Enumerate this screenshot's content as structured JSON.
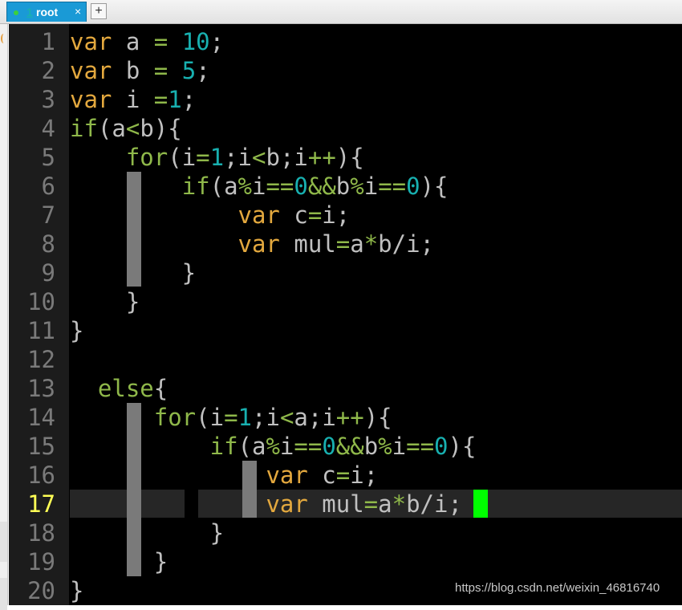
{
  "tab": {
    "index": "1",
    "name": "root",
    "close_symbol": "×",
    "new_tab_symbol": "+"
  },
  "editor": {
    "current_line": 17,
    "lines": [
      {
        "n": "1"
      },
      {
        "n": "2"
      },
      {
        "n": "3"
      },
      {
        "n": "4"
      },
      {
        "n": "5"
      },
      {
        "n": "6"
      },
      {
        "n": "7"
      },
      {
        "n": "8"
      },
      {
        "n": "9"
      },
      {
        "n": "10"
      },
      {
        "n": "11"
      },
      {
        "n": "12"
      },
      {
        "n": "13"
      },
      {
        "n": "14"
      },
      {
        "n": "15"
      },
      {
        "n": "16"
      },
      {
        "n": "17"
      },
      {
        "n": "18"
      },
      {
        "n": "19"
      },
      {
        "n": "20"
      }
    ],
    "code": [
      [
        [
          "kw",
          "var"
        ],
        [
          "t",
          " a "
        ],
        [
          "op",
          "="
        ],
        [
          "t",
          " "
        ],
        [
          "num",
          "10"
        ],
        [
          "t",
          ";"
        ]
      ],
      [
        [
          "kw",
          "var"
        ],
        [
          "t",
          " b "
        ],
        [
          "op",
          "="
        ],
        [
          "t",
          " "
        ],
        [
          "num",
          "5"
        ],
        [
          "t",
          ";"
        ]
      ],
      [
        [
          "kw",
          "var"
        ],
        [
          "t",
          " i "
        ],
        [
          "op",
          "="
        ],
        [
          "num",
          "1"
        ],
        [
          "t",
          ";"
        ]
      ],
      [
        [
          "ctl",
          "if"
        ],
        [
          "t",
          "(a"
        ],
        [
          "op",
          "<"
        ],
        [
          "t",
          "b){"
        ]
      ],
      [
        [
          "t",
          "    "
        ],
        [
          "ctl",
          "for"
        ],
        [
          "t",
          "(i"
        ],
        [
          "op",
          "="
        ],
        [
          "num",
          "1"
        ],
        [
          "t",
          ";i"
        ],
        [
          "op",
          "<"
        ],
        [
          "t",
          "b;i"
        ],
        [
          "op",
          "++"
        ],
        [
          "t",
          "){"
        ]
      ],
      [
        [
          "t",
          "        "
        ],
        [
          "ctl",
          "if"
        ],
        [
          "t",
          "(a"
        ],
        [
          "op",
          "%"
        ],
        [
          "t",
          "i"
        ],
        [
          "op",
          "=="
        ],
        [
          "num",
          "0"
        ],
        [
          "op",
          "&&"
        ],
        [
          "t",
          "b"
        ],
        [
          "op",
          "%"
        ],
        [
          "t",
          "i"
        ],
        [
          "op",
          "=="
        ],
        [
          "num",
          "0"
        ],
        [
          "t",
          "){"
        ]
      ],
      [
        [
          "t",
          "            "
        ],
        [
          "kw",
          "var"
        ],
        [
          "t",
          " c"
        ],
        [
          "op",
          "="
        ],
        [
          "t",
          "i;"
        ]
      ],
      [
        [
          "t",
          "            "
        ],
        [
          "kw",
          "var"
        ],
        [
          "t",
          " mul"
        ],
        [
          "op",
          "="
        ],
        [
          "t",
          "a"
        ],
        [
          "op",
          "*"
        ],
        [
          "t",
          "b/i;"
        ]
      ],
      [
        [
          "t",
          "        }"
        ]
      ],
      [
        [
          "t",
          "    }"
        ]
      ],
      [
        [
          "t",
          "}"
        ]
      ],
      [],
      [
        [
          "t",
          "  "
        ],
        [
          "ctl",
          "else"
        ],
        [
          "t",
          "{"
        ]
      ],
      [
        [
          "t",
          "      "
        ],
        [
          "ctl",
          "for"
        ],
        [
          "t",
          "(i"
        ],
        [
          "op",
          "="
        ],
        [
          "num",
          "1"
        ],
        [
          "t",
          ";i"
        ],
        [
          "op",
          "<"
        ],
        [
          "t",
          "a;i"
        ],
        [
          "op",
          "++"
        ],
        [
          "t",
          "){"
        ]
      ],
      [
        [
          "t",
          "          "
        ],
        [
          "ctl",
          "if"
        ],
        [
          "t",
          "(a"
        ],
        [
          "op",
          "%"
        ],
        [
          "t",
          "i"
        ],
        [
          "op",
          "=="
        ],
        [
          "num",
          "0"
        ],
        [
          "op",
          "&&"
        ],
        [
          "t",
          "b"
        ],
        [
          "op",
          "%"
        ],
        [
          "t",
          "i"
        ],
        [
          "op",
          "=="
        ],
        [
          "num",
          "0"
        ],
        [
          "t",
          "){"
        ]
      ],
      [
        [
          "t",
          "              "
        ],
        [
          "kw",
          "var"
        ],
        [
          "t",
          " c"
        ],
        [
          "op",
          "="
        ],
        [
          "t",
          "i;"
        ]
      ],
      [
        [
          "t",
          "              "
        ],
        [
          "kw",
          "var"
        ],
        [
          "t",
          " mul"
        ],
        [
          "op",
          "="
        ],
        [
          "t",
          "a"
        ],
        [
          "op",
          "*"
        ],
        [
          "t",
          "b/i;"
        ]
      ],
      [
        [
          "t",
          "          }"
        ]
      ],
      [
        [
          "t",
          "      }"
        ]
      ],
      [
        [
          "t",
          "}"
        ]
      ]
    ]
  },
  "watermark": "https://blog.csdn.net/weixin_46816740",
  "colors": {
    "keyword_var": "#e3a83e",
    "control_flow": "#8fb84a",
    "number": "#18b0b0",
    "cursor": "#00ff00",
    "current_line_number": "#ffff55",
    "tab_active": "#1a9ad6"
  }
}
